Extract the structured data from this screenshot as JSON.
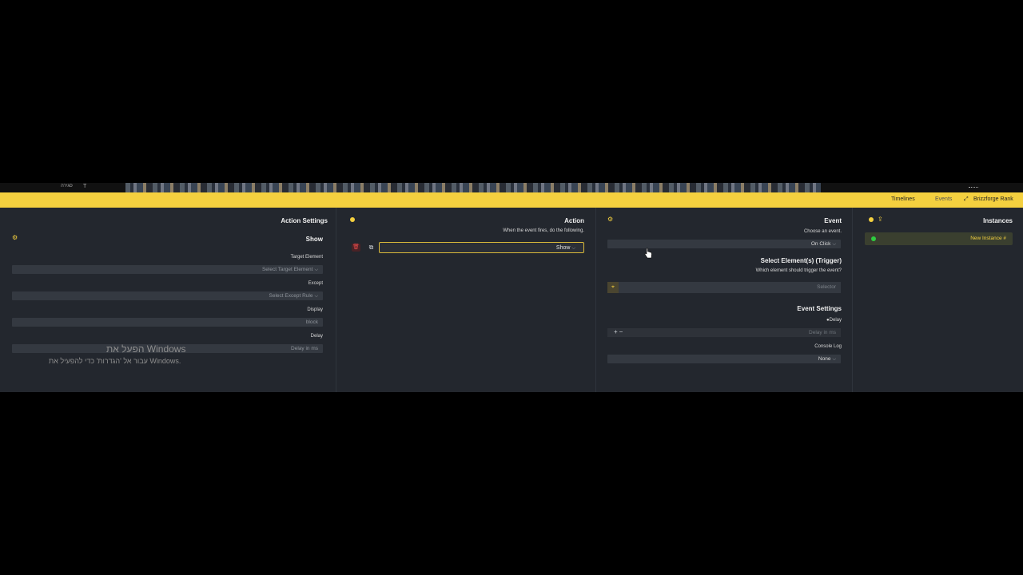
{
  "photo_strip": {
    "left_text": "סגירה",
    "tool_glyph": "T"
  },
  "topnav": {
    "items": [
      "Timelines",
      "Events",
      "Brizzforge Rank"
    ],
    "active": "Events"
  },
  "action_settings": {
    "title": "Action Settings",
    "section": "Show",
    "target_label": "Target Element",
    "target_placeholder": "Select Target Element",
    "except_label": "Except",
    "except_placeholder": "Select Except Rule",
    "display_label": "Display",
    "display_value": "block",
    "delay_label": "Delay",
    "delay_placeholder": "Delay in ms"
  },
  "action": {
    "title": "Action",
    "subtitle": "When the event fires, do the following.",
    "selected": "Show"
  },
  "event": {
    "title": "Event",
    "choose_label": "Choose an event.",
    "choose_value": "On Click",
    "trigger_title": "Select Element(s) (Trigger)",
    "trigger_sub": "Which element should trigger the event?",
    "selector_placeholder": "Selector",
    "settings_title": "Event Settings",
    "delay_label": "Delay",
    "delay_placeholder": "Delay in ms",
    "console_label": "Console Log",
    "console_value": "None"
  },
  "instances": {
    "title": "Instances",
    "item_label": "New Instance #"
  },
  "watermark": {
    "line1": "הפעל את Windows",
    "line2": "עבור אל 'הגדרות' כדי להפעיל את Windows."
  },
  "colors": {
    "accent": "#f4d03f",
    "panel": "#23272e",
    "field": "#343941",
    "status_green": "#2ecc40",
    "danger": "#e84c4c"
  }
}
